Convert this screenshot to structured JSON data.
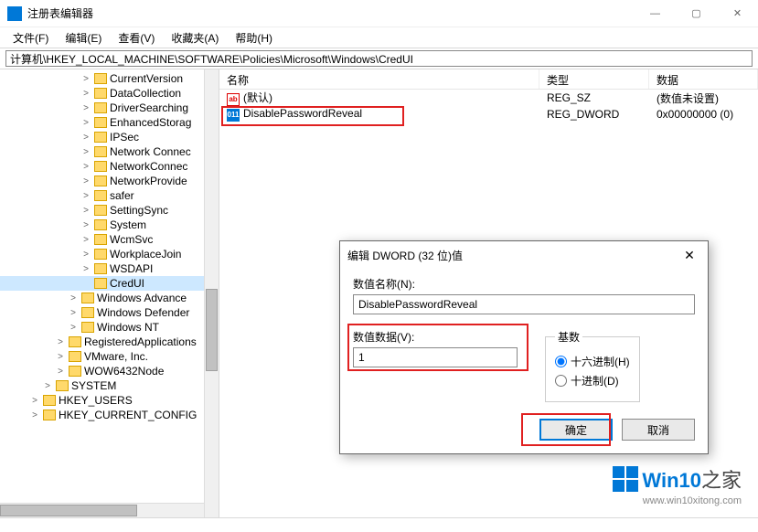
{
  "window": {
    "title": "注册表编辑器",
    "controls": {
      "min": "—",
      "max": "▢",
      "close": "✕"
    }
  },
  "menu": [
    "文件(F)",
    "编辑(E)",
    "查看(V)",
    "收藏夹(A)",
    "帮助(H)"
  ],
  "address": "计算机\\HKEY_LOCAL_MACHINE\\SOFTWARE\\Policies\\Microsoft\\Windows\\CredUI",
  "tree": [
    {
      "ind": 84,
      "exp": ">",
      "label": "CurrentVersion"
    },
    {
      "ind": 84,
      "exp": ">",
      "label": "DataCollection"
    },
    {
      "ind": 84,
      "exp": ">",
      "label": "DriverSearching"
    },
    {
      "ind": 84,
      "exp": ">",
      "label": "EnhancedStorag"
    },
    {
      "ind": 84,
      "exp": ">",
      "label": "IPSec"
    },
    {
      "ind": 84,
      "exp": ">",
      "label": "Network Connec"
    },
    {
      "ind": 84,
      "exp": ">",
      "label": "NetworkConnec"
    },
    {
      "ind": 84,
      "exp": ">",
      "label": "NetworkProvide"
    },
    {
      "ind": 84,
      "exp": ">",
      "label": "safer"
    },
    {
      "ind": 84,
      "exp": ">",
      "label": "SettingSync"
    },
    {
      "ind": 84,
      "exp": ">",
      "label": "System"
    },
    {
      "ind": 84,
      "exp": ">",
      "label": "WcmSvc"
    },
    {
      "ind": 84,
      "exp": ">",
      "label": "WorkplaceJoin"
    },
    {
      "ind": 84,
      "exp": ">",
      "label": "WSDAPI"
    },
    {
      "ind": 84,
      "exp": "",
      "label": "CredUI",
      "selected": true
    },
    {
      "ind": 70,
      "exp": ">",
      "label": "Windows Advance"
    },
    {
      "ind": 70,
      "exp": ">",
      "label": "Windows Defender"
    },
    {
      "ind": 70,
      "exp": ">",
      "label": "Windows NT"
    },
    {
      "ind": 56,
      "exp": ">",
      "label": "RegisteredApplications"
    },
    {
      "ind": 56,
      "exp": ">",
      "label": "VMware, Inc."
    },
    {
      "ind": 56,
      "exp": ">",
      "label": "WOW6432Node"
    },
    {
      "ind": 42,
      "exp": ">",
      "label": "SYSTEM"
    },
    {
      "ind": 28,
      "exp": ">",
      "label": "HKEY_USERS"
    },
    {
      "ind": 28,
      "exp": ">",
      "label": "HKEY_CURRENT_CONFIG"
    }
  ],
  "list": {
    "headers": {
      "name": "名称",
      "type": "类型",
      "data": "数据"
    },
    "rows": [
      {
        "icon": "str",
        "iconText": "ab",
        "name": "(默认)",
        "type": "REG_SZ",
        "data": "(数值未设置)"
      },
      {
        "icon": "bin",
        "iconText": "011",
        "name": "DisablePasswordReveal",
        "type": "REG_DWORD",
        "data": "0x00000000 (0)"
      }
    ]
  },
  "dialog": {
    "title": "编辑 DWORD (32 位)值",
    "nameLabel": "数值名称(N):",
    "nameValue": "DisablePasswordReveal",
    "valueLabel": "数值数据(V):",
    "valueValue": "1",
    "baseLabel": "基数",
    "hex": "十六进制(H)",
    "dec": "十进制(D)",
    "ok": "确定",
    "cancel": "取消"
  },
  "watermark": {
    "text1": "Win10",
    "text2": "之家",
    "url": "www.win10xitong.com"
  }
}
